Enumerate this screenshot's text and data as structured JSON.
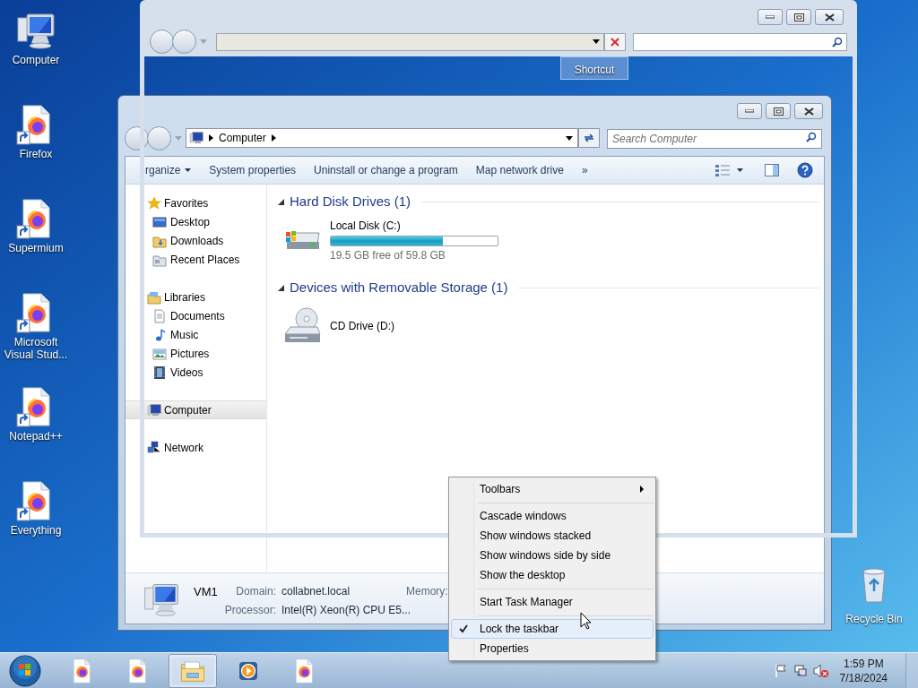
{
  "desktop_icons": [
    {
      "label": "Computer",
      "kind": "computer"
    },
    {
      "label": "Firefox",
      "kind": "shortcut"
    },
    {
      "label": "Supermium",
      "kind": "shortcut"
    },
    {
      "label": "Microsoft Visual Stud...",
      "kind": "shortcut"
    },
    {
      "label": "Notepad++",
      "kind": "shortcut"
    },
    {
      "label": "Everything",
      "kind": "shortcut"
    }
  ],
  "recycle_bin": {
    "label": "Recycle Bin"
  },
  "selected_desktop_icon": {
    "label": "Shortcut"
  },
  "explorer": {
    "breadcrumb": [
      "Computer"
    ],
    "search_placeholder": "Search Computer",
    "toolbar": [
      {
        "label": "rganize",
        "dropdown": true
      },
      {
        "label": "System properties",
        "dropdown": false
      },
      {
        "label": "Uninstall or change a program",
        "dropdown": false
      },
      {
        "label": "Map network drive",
        "dropdown": false
      },
      {
        "label": "»",
        "dropdown": false
      }
    ],
    "navigation": [
      {
        "label": "Favorites",
        "kind": "star",
        "selected": false,
        "children": [
          {
            "label": "Desktop",
            "kind": "desktop",
            "selected": false
          },
          {
            "label": "Downloads",
            "kind": "downloads",
            "selected": false
          },
          {
            "label": "Recent Places",
            "kind": "recent",
            "selected": false
          }
        ]
      },
      {
        "label": "Libraries",
        "kind": "libraries",
        "selected": false,
        "children": [
          {
            "label": "Documents",
            "kind": "documents",
            "selected": false
          },
          {
            "label": "Music",
            "kind": "music",
            "selected": false
          },
          {
            "label": "Pictures",
            "kind": "pictures",
            "selected": false
          },
          {
            "label": "Videos",
            "kind": "videos",
            "selected": false
          }
        ]
      },
      {
        "label": "Computer",
        "kind": "computer",
        "selected": true
      },
      {
        "label": "Network",
        "kind": "network",
        "selected": false
      }
    ],
    "groups": [
      {
        "title": "Hard Disk Drives (1)",
        "expanded": true,
        "items": [
          {
            "label": "Local Disk (C:)",
            "kind": "hdd",
            "level": 0.674,
            "free_text": "19.5 GB free of 59.8 GB"
          }
        ]
      },
      {
        "title": "Devices with Removable Storage (1)",
        "expanded": true,
        "items": [
          {
            "label": "CD Drive (D:)",
            "kind": "cd"
          }
        ]
      }
    ],
    "details": {
      "name": "VM1",
      "fields": [
        {
          "label": "Domain:",
          "value": "collabnet.local"
        },
        {
          "label": "Memory:"
        },
        {
          "label": "Processor:",
          "value": "Intel(R) Xeon(R) CPU E5..."
        }
      ]
    }
  },
  "context_menu": {
    "groups": [
      [
        {
          "label": "Toolbars",
          "submenu": true,
          "checked": false,
          "highlighted": false
        }
      ],
      [
        {
          "label": "Cascade windows",
          "submenu": false,
          "checked": false,
          "highlighted": false
        },
        {
          "label": "Show windows stacked",
          "submenu": false,
          "checked": false,
          "highlighted": false
        },
        {
          "label": "Show windows side by side",
          "submenu": false,
          "checked": false,
          "highlighted": false
        },
        {
          "label": "Show the desktop",
          "submenu": false,
          "checked": false,
          "highlighted": false
        }
      ],
      [
        {
          "label": "Start Task Manager",
          "submenu": false,
          "checked": false,
          "highlighted": false
        }
      ],
      [
        {
          "label": "Lock the taskbar",
          "submenu": false,
          "checked": true,
          "highlighted": true
        },
        {
          "label": "Properties",
          "submenu": false,
          "checked": false,
          "highlighted": false
        }
      ]
    ]
  },
  "taskbar": {
    "items": [
      {
        "kind": "firefox-doc",
        "selected": false
      },
      {
        "kind": "firefox-doc",
        "selected": false
      },
      {
        "kind": "explorer",
        "selected": true
      },
      {
        "kind": "media",
        "selected": false
      },
      {
        "kind": "firefox-doc",
        "selected": false
      }
    ],
    "volume_muted": true,
    "time": "1:59 PM",
    "date": "7/18/2024"
  }
}
